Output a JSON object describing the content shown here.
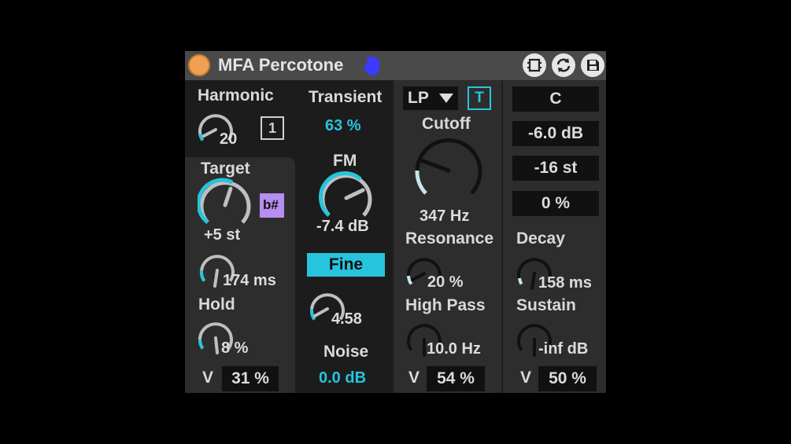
{
  "device": {
    "title": "MFA Percotone",
    "icons": {
      "power": "power-icon",
      "hand": "hand-icon",
      "toolbar": [
        "chip-icon",
        "refresh-icon",
        "save-icon"
      ]
    },
    "colors": {
      "accent": "#27c4dd",
      "power": "#f0a052",
      "purple": "#b58ef0",
      "hand": "#3b3bff"
    }
  },
  "harmonic": {
    "label": "Harmonic",
    "knob_value": "20",
    "toggle": "1"
  },
  "target": {
    "label": "Target",
    "value": "+5 st",
    "flat_sharp": "b#"
  },
  "decay_left": {
    "value": "174 ms"
  },
  "hold": {
    "label": "Hold",
    "value": "8 %"
  },
  "velocity_left": {
    "label": "V",
    "value": "31 %"
  },
  "transient": {
    "label": "Transient",
    "value": "63 %"
  },
  "fm": {
    "label": "FM",
    "value": "-7.4 dB"
  },
  "fine": {
    "label": "Fine",
    "knob_value": "4.58"
  },
  "noise": {
    "label": "Noise",
    "value": "0.0 dB"
  },
  "filter": {
    "type": "LP",
    "t_toggle": "T",
    "cutoff_label": "Cutoff",
    "cutoff_value": "347 Hz",
    "resonance_label": "Resonance",
    "resonance_value": "20 %",
    "highpass_label": "High Pass",
    "highpass_value": "10.0 Hz"
  },
  "velocity_filter": {
    "label": "V",
    "value": "54 %"
  },
  "right": {
    "note": "C",
    "gain": "-6.0 dB",
    "transpose": "-16 st",
    "amount": "0 %",
    "decay_label": "Decay",
    "decay_value": "158 ms",
    "sustain_label": "Sustain",
    "sustain_value": "-inf dB"
  },
  "velocity_right": {
    "label": "V",
    "value": "50 %"
  }
}
